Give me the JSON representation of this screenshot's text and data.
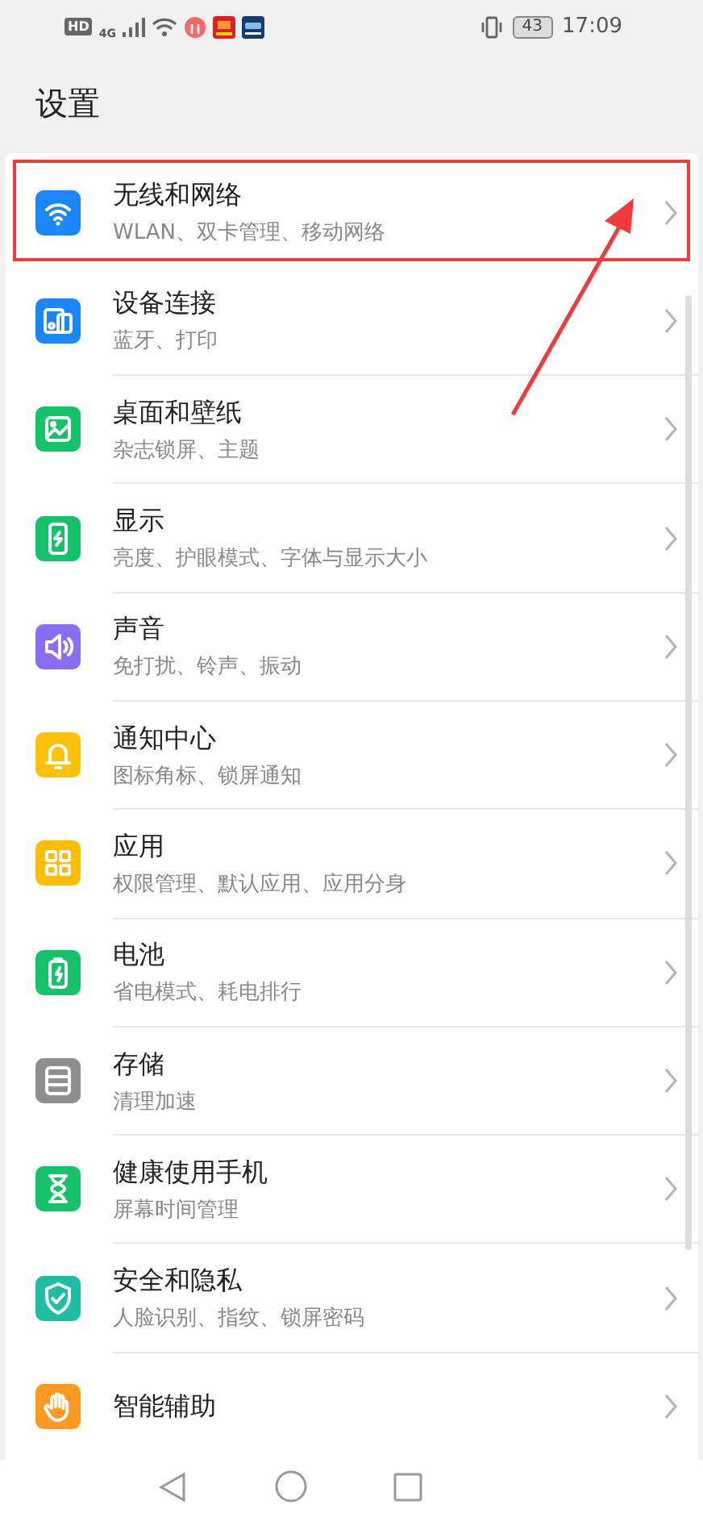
{
  "status_bar": {
    "hd": "HD",
    "network": "4G",
    "battery": "43",
    "time": "17:09"
  },
  "title": "设置",
  "items": [
    {
      "kind": "wifi",
      "color": "#1a86fb",
      "title": "无线和网络",
      "subtitle": "WLAN、双卡管理、移动网络",
      "highlighted": true
    },
    {
      "kind": "devices",
      "color": "#1a86fb",
      "title": "设备连接",
      "subtitle": "蓝牙、打印",
      "highlighted": false
    },
    {
      "kind": "image",
      "color": "#14c26a",
      "title": "桌面和壁纸",
      "subtitle": "杂志锁屏、主题",
      "highlighted": false
    },
    {
      "kind": "phone",
      "color": "#14c26a",
      "title": "显示",
      "subtitle": "亮度、护眼模式、字体与显示大小",
      "highlighted": false
    },
    {
      "kind": "speaker",
      "color": "#8b6cf4",
      "title": "声音",
      "subtitle": "免打扰、铃声、振动",
      "highlighted": false
    },
    {
      "kind": "bell",
      "color": "#ffc107",
      "title": "通知中心",
      "subtitle": "图标角标、锁屏通知",
      "highlighted": false
    },
    {
      "kind": "grid",
      "color": "#ffbf00",
      "title": "应用",
      "subtitle": "权限管理、默认应用、应用分身",
      "highlighted": false
    },
    {
      "kind": "battery",
      "color": "#14c26a",
      "title": "电池",
      "subtitle": "省电模式、耗电排行",
      "highlighted": false
    },
    {
      "kind": "storage",
      "color": "#8f8f8f",
      "title": "存储",
      "subtitle": "清理加速",
      "highlighted": false
    },
    {
      "kind": "hourglass",
      "color": "#14c26a",
      "title": "健康使用手机",
      "subtitle": "屏幕时间管理",
      "highlighted": false
    },
    {
      "kind": "shield",
      "color": "#1dbfa4",
      "title": "安全和隐私",
      "subtitle": "人脸识别、指纹、锁屏密码",
      "highlighted": false
    },
    {
      "kind": "hand",
      "color": "#ff9a1f",
      "title": "智能辅助",
      "highlighted": false
    }
  ]
}
